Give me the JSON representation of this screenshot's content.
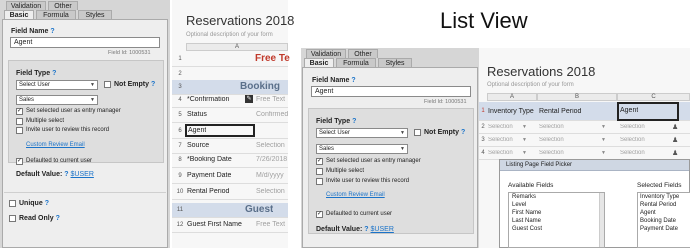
{
  "left": {
    "tabs_back": [
      "Validation",
      "Other"
    ],
    "tabs_front": [
      "Basic",
      "Formula",
      "Styles"
    ],
    "field_name_label": "Field Name",
    "field_name_value": "Agent",
    "field_id": "Field Id: 1000531",
    "field_type_label": "Field Type",
    "field_type_value": "Select User",
    "not_empty_label": "Not Empty",
    "group_value": "Sales",
    "options": [
      {
        "label": "Set selected user as entry manager",
        "checked": true
      },
      {
        "label": "Multiple select",
        "checked": false
      },
      {
        "label": "Invite user to review this record",
        "checked": false
      }
    ],
    "custom_review_email": "Custom Review Email",
    "defaulted_label": "Defaulted to current user",
    "default_value_label": "Default Value:",
    "default_value_link": "$USER",
    "unique_label": "Unique",
    "read_only_label": "Read Only",
    "q": "?"
  },
  "middle": {
    "title": "Reservations 2018",
    "description": "Optional description of your form",
    "col_a": "A",
    "free_text_heading": "Free Te",
    "booking_heading": "Booking",
    "guest_heading": "Guest",
    "rows": [
      {
        "n": "1",
        "label": "",
        "value": ""
      },
      {
        "n": "2",
        "label": "",
        "value": ""
      },
      {
        "n": "3",
        "label": "",
        "value": ""
      },
      {
        "n": "4",
        "label": "*Confirmation",
        "value": "Free Text"
      },
      {
        "n": "5",
        "label": "Status",
        "value": "Confirmed"
      },
      {
        "n": "6",
        "label": "Agent",
        "value": ""
      },
      {
        "n": "7",
        "label": "Source",
        "value": "Selection"
      },
      {
        "n": "8",
        "label": "*Booking Date",
        "value": "7/26/2018"
      },
      {
        "n": "9",
        "label": "Payment Date",
        "value": "M/d/yyyy"
      },
      {
        "n": "10",
        "label": "Rental Period",
        "value": "Selection"
      },
      {
        "n": "11",
        "label": "",
        "value": ""
      },
      {
        "n": "12",
        "label": "Guest First Name",
        "value": "Free Text"
      }
    ]
  },
  "right": {
    "heading": "List View",
    "tabs_back": [
      "Validation",
      "Other"
    ],
    "tabs_front": [
      "Basic",
      "Formula",
      "Styles"
    ],
    "field_name_label": "Field Name",
    "field_name_value": "Agent",
    "field_id": "Field Id: 1000531",
    "field_type_label": "Field Type",
    "field_type_value": "Select User",
    "not_empty_label": "Not Empty",
    "group_value": "Sales",
    "options": [
      {
        "label": "Set selected user as entry manager",
        "checked": true
      },
      {
        "label": "Multiple select",
        "checked": false
      },
      {
        "label": "Invite user to review this record",
        "checked": false
      }
    ],
    "custom_review_email": "Custom Review Email",
    "defaulted_label": "Defaulted to current user",
    "default_value_label": "Default Value:",
    "default_value_link": "$USER",
    "q": "?",
    "list_title": "Reservations 2018",
    "list_description": "Optional description of your form",
    "col_headers": [
      "A",
      "B",
      "C"
    ],
    "list_headers": [
      "Inventory Type",
      "Rental Period",
      "Agent"
    ],
    "selection": "Selection",
    "picker_title": "Listing Page Field Picker",
    "available_label": "Available Fields",
    "selected_label": "Selected Fields",
    "available": [
      "Remarks",
      "Level",
      "First Name",
      "Last Name",
      "Guest Cost"
    ],
    "selected": [
      "Inventory Type",
      "Rental Period",
      "Agent",
      "Booking Date",
      "Payment Date"
    ]
  }
}
